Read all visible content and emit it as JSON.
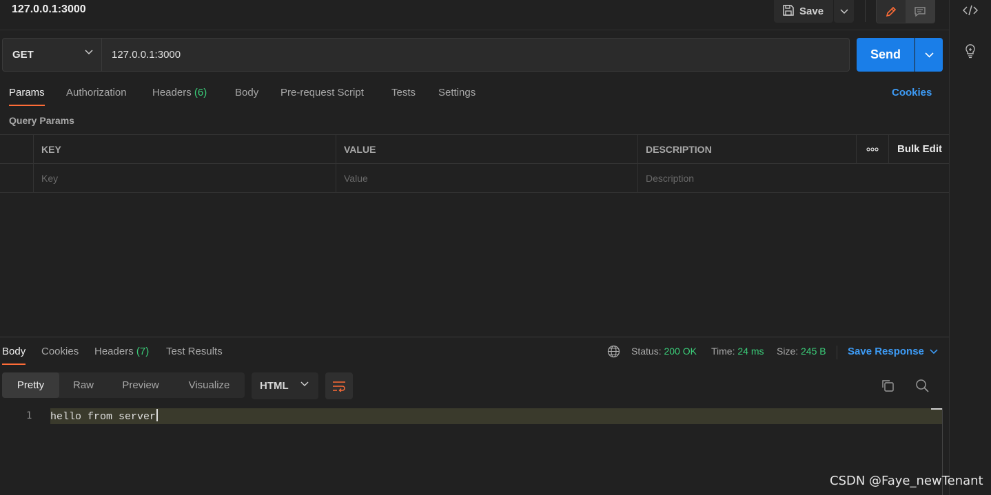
{
  "request": {
    "title": "127.0.0.1:3000",
    "method": "GET",
    "url": "127.0.0.1:3000"
  },
  "toolbar": {
    "save_label": "Save",
    "send_label": "Send"
  },
  "request_tabs": [
    {
      "label": "Params",
      "count": ""
    },
    {
      "label": "Authorization",
      "count": ""
    },
    {
      "label": "Headers",
      "count": "(6)"
    },
    {
      "label": "Body",
      "count": ""
    },
    {
      "label": "Pre-request Script",
      "count": ""
    },
    {
      "label": "Tests",
      "count": ""
    },
    {
      "label": "Settings",
      "count": ""
    }
  ],
  "cookies_link": "Cookies",
  "query_params": {
    "section_label": "Query Params",
    "columns": [
      "KEY",
      "VALUE",
      "DESCRIPTION"
    ],
    "bulk_edit_label": "Bulk Edit",
    "placeholders": {
      "key": "Key",
      "value": "Value",
      "description": "Description"
    }
  },
  "response": {
    "tabs": [
      {
        "label": "Body",
        "count": ""
      },
      {
        "label": "Cookies",
        "count": ""
      },
      {
        "label": "Headers",
        "count": "(7)"
      },
      {
        "label": "Test Results",
        "count": ""
      }
    ],
    "status_label": "Status:",
    "status_value": "200 OK",
    "time_label": "Time:",
    "time_value": "24 ms",
    "size_label": "Size:",
    "size_value": "245 B",
    "save_response_label": "Save Response",
    "view_modes": [
      "Pretty",
      "Raw",
      "Preview",
      "Visualize"
    ],
    "format": "HTML",
    "lines": [
      {
        "number": "1",
        "text": "hello from server"
      }
    ]
  },
  "watermark": "CSDN @Faye_newTenant",
  "colors": {
    "accent": "#1a7ee8",
    "active_tab": "#ff6c37",
    "success": "#3bcf7a",
    "link": "#3d9bf5"
  }
}
